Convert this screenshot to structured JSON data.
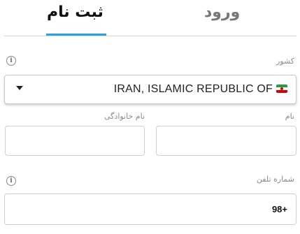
{
  "tabs": {
    "login_label": "ورود",
    "signup_label": "ثبت نام",
    "active": "signup"
  },
  "form": {
    "country": {
      "label": "کشور",
      "selected_value": "IRAN, ISLAMIC REPUBLIC OF",
      "flag_icon": "iran-flag-icon",
      "info_icon": "info-icon"
    },
    "first_name": {
      "label": "نام",
      "value": ""
    },
    "last_name": {
      "label": "نام خانوادگی",
      "value": ""
    },
    "phone": {
      "label": "شماره تلفن",
      "prefix": "98+",
      "value": "",
      "info_icon": "info-icon"
    }
  },
  "colors": {
    "accent": "#29a3df",
    "active_tab_text": "#111111",
    "inactive_tab_text": "#777777"
  }
}
